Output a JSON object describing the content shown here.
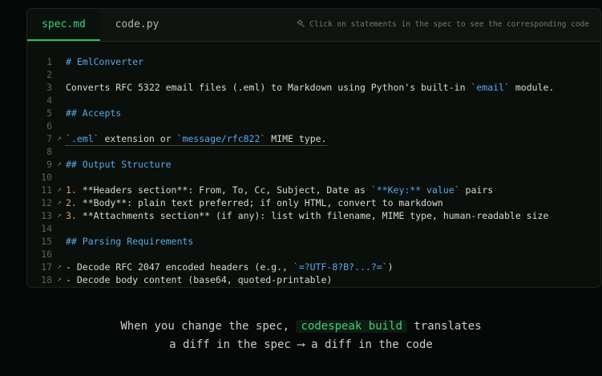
{
  "tabs": [
    {
      "label": "spec.md",
      "active": true
    },
    {
      "label": "code.py",
      "active": false
    }
  ],
  "hint": {
    "text": "Click on statements in the spec to see the corresponding code"
  },
  "lines": [
    {
      "n": "1",
      "mark": "",
      "text": "# EmlConverter"
    },
    {
      "n": "2",
      "mark": "",
      "text": ""
    },
    {
      "n": "3",
      "mark": "",
      "text": "Converts RFC 5322 email files (.eml) to Markdown using Python's built-in `email` module."
    },
    {
      "n": "4",
      "mark": "",
      "text": ""
    },
    {
      "n": "5",
      "mark": "",
      "text": "## Accepts"
    },
    {
      "n": "6",
      "mark": "",
      "text": ""
    },
    {
      "n": "7",
      "mark": "↗",
      "text": "`.eml` extension or `message/rfc822` MIME type."
    },
    {
      "n": "8",
      "mark": "",
      "text": ""
    },
    {
      "n": "9",
      "mark": "↗",
      "text": "## Output Structure"
    },
    {
      "n": "10",
      "mark": "",
      "text": ""
    },
    {
      "n": "11",
      "mark": "↗",
      "text": "1. **Headers section**: From, To, Cc, Subject, Date as `**Key:** value` pairs"
    },
    {
      "n": "12",
      "mark": "↗",
      "text": "2. **Body**: plain text preferred; if only HTML, convert to markdown"
    },
    {
      "n": "13",
      "mark": "↗",
      "text": "3. **Attachments section** (if any): list with filename, MIME type, human-readable size"
    },
    {
      "n": "14",
      "mark": "",
      "text": ""
    },
    {
      "n": "15",
      "mark": "",
      "text": "## Parsing Requirements"
    },
    {
      "n": "16",
      "mark": "",
      "text": ""
    },
    {
      "n": "17",
      "mark": "↗",
      "text": "- Decode RFC 2047 encoded headers (e.g., `=?UTF-8?B?...?=`)"
    },
    {
      "n": "18",
      "mark": "↗",
      "text": "- Decode body content (base64, quoted-printable)"
    }
  ],
  "caption": {
    "line1_pre": "When you change the spec,",
    "line1_kw": "codespeak build",
    "line1_post": "translates",
    "line2": "a diff in the spec ⟶ a diff in the code"
  },
  "colors": {
    "accent": "#3fd07a",
    "heading": "#56a9e8",
    "number": "#e3a25a",
    "background": "#050806"
  }
}
